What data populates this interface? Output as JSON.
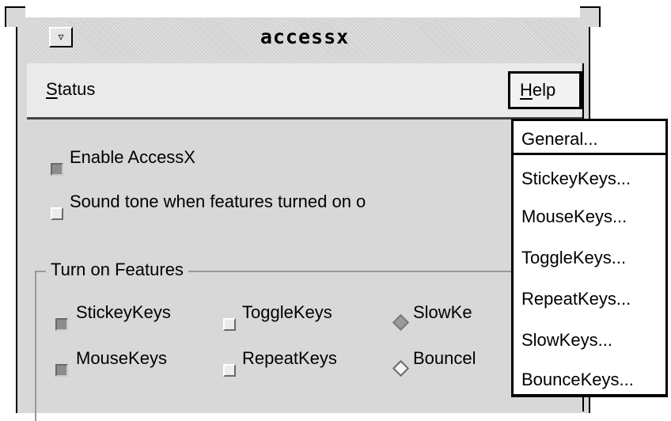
{
  "window": {
    "title": "accessx",
    "menu_button_glyph": "▿"
  },
  "menubar": {
    "status": {
      "mnemonic": "S",
      "rest": "tatus"
    },
    "help": {
      "mnemonic": "H",
      "rest": "elp"
    }
  },
  "options": {
    "enable_accessx": {
      "label": "Enable AccessX",
      "checked": true
    },
    "sound_tone": {
      "label": "Sound tone when features turned on o",
      "checked": false
    }
  },
  "features": {
    "title": "Turn on Features",
    "stickeykeys": {
      "label": "StickeyKeys",
      "checked": true
    },
    "togglekeys": {
      "label": "ToggleKeys",
      "checked": false
    },
    "slowkeys": {
      "label": "SlowKe",
      "checked": true
    },
    "mousekeys": {
      "label": "MouseKeys",
      "checked": true
    },
    "repeatkeys": {
      "label": "RepeatKeys",
      "checked": false
    },
    "bouncekeys": {
      "label": "Bouncel",
      "checked": false
    }
  },
  "help_menu": {
    "items": [
      "General...",
      "StickeyKeys...",
      "MouseKeys...",
      "ToggleKeys...",
      "RepeatKeys...",
      "SlowKeys...",
      "BounceKeys..."
    ]
  },
  "colors": {
    "window_bg": "#d8d8d8",
    "menubar_bg": "#eaeaea",
    "dropdown_bg": "#ffffff"
  }
}
